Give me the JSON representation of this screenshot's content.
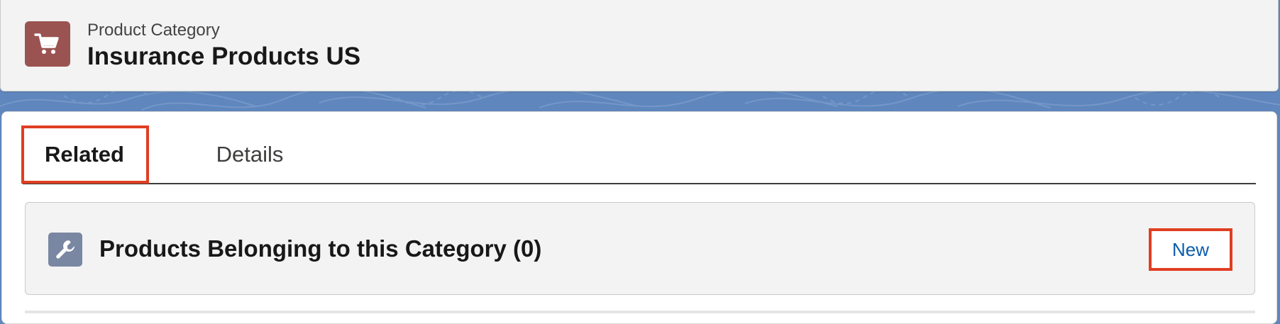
{
  "header": {
    "icon": "shopping-cart-icon",
    "object_type": "Product Category",
    "record_name": "Insurance Products US"
  },
  "tabs": [
    {
      "label": "Related",
      "active": true
    },
    {
      "label": "Details",
      "active": false
    }
  ],
  "related_list": {
    "icon": "wrench-icon",
    "title": "Products Belonging to this Category (0)",
    "new_button_label": "New"
  },
  "colors": {
    "header_icon_bg": "#9b5352",
    "list_icon_bg": "#7a87a3",
    "brand_blue": "#0b5cab",
    "highlight_red": "#e03e22",
    "page_background": "#5f86bd"
  }
}
